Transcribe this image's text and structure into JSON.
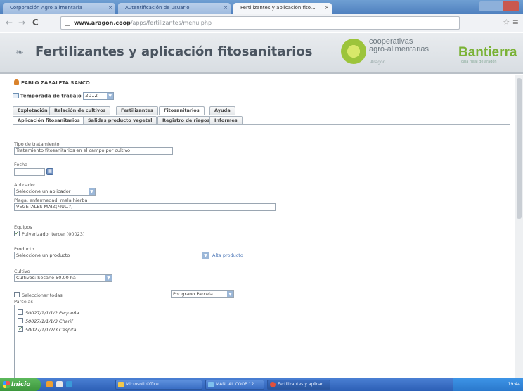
{
  "browser": {
    "tabs": [
      {
        "label": "Corporación Agro alimentaria"
      },
      {
        "label": "Autentificación de usuario"
      },
      {
        "label": "Fertilizantes y aplicación fito..."
      }
    ],
    "url_domain": "www.aragon.coop",
    "url_path": "/apps/fertilizantes/menu.php",
    "back_icon": "back-arrow-icon",
    "forward_icon": "forward-arrow-icon",
    "reload_icon": "reload-icon"
  },
  "header": {
    "title": "Fertilizantes y aplicación fitosanitarios",
    "logo_text_line1": "cooperativas",
    "logo_text_line2": "agro-alimentarias",
    "logo_sub": "Aragón",
    "bank_name": "Bantierra",
    "bank_sub": "caja rural de aragón",
    "accent_color": "#7ab235"
  },
  "user": {
    "name": "PABLO ZABALETA SANCO"
  },
  "season": {
    "label": "Temporada de trabajo",
    "value": "2012"
  },
  "main_tabs": [
    "Explotación",
    "Relación de cultivos",
    "Fertilizantes",
    "Fitosanitarios",
    "Ayuda"
  ],
  "main_tabs_active": "Fitosanitarios",
  "sub_tabs": [
    "Aplicación fitosanitarios",
    "Salidas producto vegetal",
    "Registro de riegos",
    "Informes"
  ],
  "sub_tabs_active": "Aplicación fitosanitarios",
  "form": {
    "treatment_type_label": "Tipo de tratamiento",
    "treatment_type_value": "Tratamiento fitosanitarios en el campo por cultivo",
    "date_label": "Fecha",
    "date_value": "",
    "applicator_label": "Aplicador",
    "applicator_value": "Seleccione un aplicador",
    "pest_label": "Plaga, enfermedad, mala hierba",
    "pest_value": "VEGETALES MAIZ(MUL.?)",
    "equipment_label": "Equipos",
    "equipment_item": "Pulverizador tercer (00023)",
    "product_label": "Producto",
    "product_value": "Seleccione un producto",
    "new_product_link": "Alta producto",
    "crop_label": "Cultivo",
    "crop_value": "Cultivos: Secano 50.00 ha",
    "select_all_label": "Seleccionar todas",
    "group_by_value": "Por grano Parcela",
    "parcels_label": "Parcelas",
    "parcels": [
      {
        "label": "50027/1/1/1/2 Pequeña",
        "checked": false
      },
      {
        "label": "50027/1/1/1/3 Charif",
        "checked": false
      },
      {
        "label": "50027/1/1/2/3 Cespita",
        "checked": true
      }
    ]
  },
  "taskbar": {
    "start_label": "Inicio",
    "tasks": [
      {
        "label": "Microsoft Office"
      },
      {
        "label": "MANUAL COOP 12..."
      },
      {
        "label": "Fertilizantes y aplicac..."
      }
    ],
    "clock": "19:44"
  }
}
